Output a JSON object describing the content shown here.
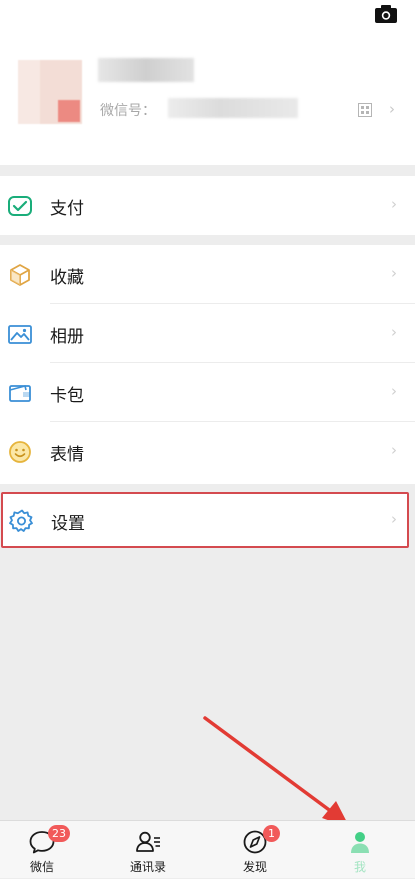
{
  "profile": {
    "wechat_id_label": "微信号："
  },
  "menu": {
    "pay": {
      "label": "支付",
      "icon": "wechat-pay-icon"
    },
    "main_items": [
      {
        "label": "收藏",
        "icon": "favorites-cube-icon"
      },
      {
        "label": "相册",
        "icon": "album-photo-icon"
      },
      {
        "label": "卡包",
        "icon": "card-wallet-icon"
      },
      {
        "label": "表情",
        "icon": "sticker-smile-icon"
      }
    ],
    "settings": {
      "label": "设置",
      "icon": "gear-icon"
    }
  },
  "tabbar": {
    "items": [
      {
        "label": "微信",
        "icon": "chat-bubble-icon",
        "badge": "23"
      },
      {
        "label": "通讯录",
        "icon": "contacts-icon"
      },
      {
        "label": "发现",
        "icon": "compass-icon",
        "badge": "1"
      },
      {
        "label": "我",
        "icon": "me-person-icon"
      }
    ]
  },
  "colors": {
    "accent_green": "#07c160",
    "badge_red": "#f15a5a",
    "highlight_red": "#d44a4f",
    "background": "#ededed"
  }
}
